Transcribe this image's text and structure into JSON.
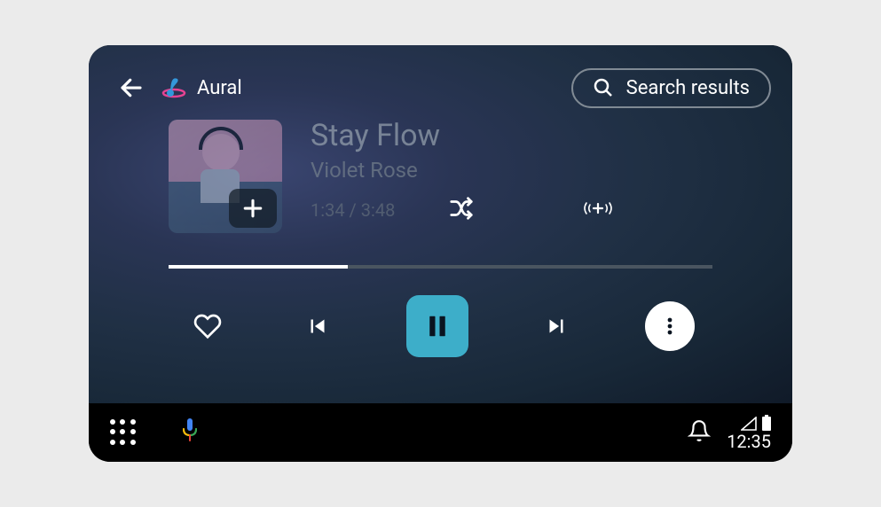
{
  "app": {
    "name": "Aural"
  },
  "search": {
    "label": "Search results"
  },
  "track": {
    "title": "Stay Flow",
    "artist": "Violet Rose",
    "elapsed": "1:34",
    "duration": "3:48",
    "time_display": "1:34 / 3:48",
    "progress_percent": 33
  },
  "system": {
    "time": "12:35"
  },
  "colors": {
    "accent": "#3daec9"
  }
}
